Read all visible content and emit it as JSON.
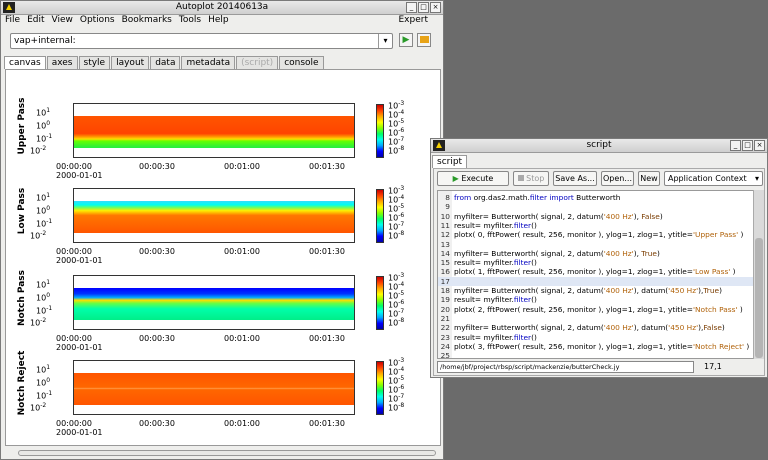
{
  "main_window": {
    "title": "Autoplot 20140613a",
    "menu": [
      "File",
      "Edit",
      "View",
      "Options",
      "Bookmarks",
      "Tools",
      "Help"
    ],
    "expert_label": "Expert",
    "address_value": "vap+internal:",
    "tabs": [
      "canvas",
      "axes",
      "style",
      "layout",
      "data",
      "metadata",
      "(script)",
      "console"
    ],
    "active_tab": "canvas"
  },
  "plots": [
    {
      "label": "Upper Pass",
      "yticks": [
        "10",
        "10",
        "10"
      ],
      "yexp": [
        "1",
        "0",
        "-1"
      ],
      "ytick_last": "10",
      "yexp_last": "-2"
    },
    {
      "label": "Low Pass",
      "yticks": [
        "10",
        "10",
        "10"
      ],
      "yexp": [
        "1",
        "0",
        "-1"
      ],
      "ytick_last": "10",
      "yexp_last": "-2"
    },
    {
      "label": "Notch Pass",
      "yticks": [
        "10",
        "10",
        "10"
      ],
      "yexp": [
        "1",
        "0",
        "-1"
      ],
      "ytick_last": "10",
      "yexp_last": "-2"
    },
    {
      "label": "Notch Reject",
      "yticks": [
        "10",
        "10",
        "10"
      ],
      "yexp": [
        "1",
        "0",
        "-1"
      ],
      "ytick_last": "10",
      "yexp_last": "-2"
    }
  ],
  "xaxis": {
    "ticks": [
      "00:00:00",
      "00:00:30",
      "00:01:00",
      "00:01:30"
    ],
    "date": "2000-01-01"
  },
  "colorbar": {
    "base": "10",
    "exps": [
      "-3",
      "-4",
      "-5",
      "-6",
      "-7",
      "-8"
    ]
  },
  "script_window": {
    "title": "script",
    "tab": "script",
    "buttons": {
      "execute": "Execute",
      "stop": "Stop",
      "save_as": "Save As...",
      "open": "Open...",
      "new": "New"
    },
    "context": "Application Context",
    "path": "/home/jbf/project/rbsp/script/mackenzie/butterCheck.jy",
    "position": "17,1",
    "lines": [
      {
        "n": "8",
        "parts": [
          [
            "kw",
            "from "
          ],
          [
            "",
            "org.das2.math."
          ],
          [
            "kw",
            "filter"
          ],
          [
            "kw",
            " import "
          ],
          [
            "",
            "Butterworth"
          ]
        ]
      },
      {
        "n": "9",
        "parts": []
      },
      {
        "n": "10",
        "parts": [
          [
            "",
            "myfilter= Butterworth( signal, 2, datum("
          ],
          [
            "str",
            "'400 Hz'"
          ],
          [
            "",
            "), "
          ],
          [
            "cst",
            "False"
          ],
          [
            "",
            ")"
          ]
        ]
      },
      {
        "n": "11",
        "parts": [
          [
            "",
            "result= myfilter."
          ],
          [
            "kw",
            "filter"
          ],
          [
            "",
            "()"
          ]
        ]
      },
      {
        "n": "12",
        "parts": [
          [
            "",
            "plotx( 0, fftPower( result, 256, monitor ), ylog=1, zlog=1, ytitle="
          ],
          [
            "str",
            "'Upper Pass'"
          ],
          [
            "",
            " )"
          ]
        ]
      },
      {
        "n": "13",
        "parts": []
      },
      {
        "n": "14",
        "parts": [
          [
            "",
            "myfilter= Butterworth( signal, 2, datum("
          ],
          [
            "str",
            "'400 Hz'"
          ],
          [
            "",
            "), "
          ],
          [
            "cst",
            "True"
          ],
          [
            "",
            ")"
          ]
        ]
      },
      {
        "n": "15",
        "parts": [
          [
            "",
            "result= myfilter."
          ],
          [
            "kw",
            "filter"
          ],
          [
            "",
            "()"
          ]
        ]
      },
      {
        "n": "16",
        "parts": [
          [
            "",
            "plotx( 1, fftPower( result, 256, monitor ), ylog=1, zlog=1, ytitle="
          ],
          [
            "str",
            "'Low Pass'"
          ],
          [
            "",
            " )"
          ]
        ]
      },
      {
        "n": "17",
        "parts": [],
        "hl": true
      },
      {
        "n": "18",
        "parts": [
          [
            "",
            "myfilter= Butterworth( signal, 2, datum("
          ],
          [
            "str",
            "'400 Hz'"
          ],
          [
            "",
            "), datum("
          ],
          [
            "str",
            "'450 Hz'"
          ],
          [
            "",
            "),"
          ],
          [
            "cst",
            "True"
          ],
          [
            "",
            ")"
          ]
        ]
      },
      {
        "n": "19",
        "parts": [
          [
            "",
            "result= myfilter."
          ],
          [
            "kw",
            "filter"
          ],
          [
            "",
            "()"
          ]
        ]
      },
      {
        "n": "20",
        "parts": [
          [
            "",
            "plotx( 2, fftPower( result, 256, monitor ), ylog=1, zlog=1, ytitle="
          ],
          [
            "str",
            "'Notch Pass'"
          ],
          [
            "",
            " )"
          ]
        ]
      },
      {
        "n": "21",
        "parts": []
      },
      {
        "n": "22",
        "parts": [
          [
            "",
            "myfilter= Butterworth( signal, 2, datum("
          ],
          [
            "str",
            "'400 Hz'"
          ],
          [
            "",
            "), datum("
          ],
          [
            "str",
            "'450 Hz'"
          ],
          [
            "",
            "),"
          ],
          [
            "cst",
            "False"
          ],
          [
            "",
            ")"
          ]
        ]
      },
      {
        "n": "23",
        "parts": [
          [
            "",
            "result= myfilter."
          ],
          [
            "kw",
            "filter"
          ],
          [
            "",
            "()"
          ]
        ]
      },
      {
        "n": "24",
        "parts": [
          [
            "",
            "plotx( 3, fftPower( result, 256, monitor ), ylog=1, zlog=1, ytitle="
          ],
          [
            "str",
            "'Notch Reject'"
          ],
          [
            "",
            " )"
          ]
        ]
      },
      {
        "n": "25",
        "parts": []
      }
    ]
  },
  "colors": {
    "accent_green": "#2a9a2a",
    "folder_orange": "#e8a317"
  }
}
